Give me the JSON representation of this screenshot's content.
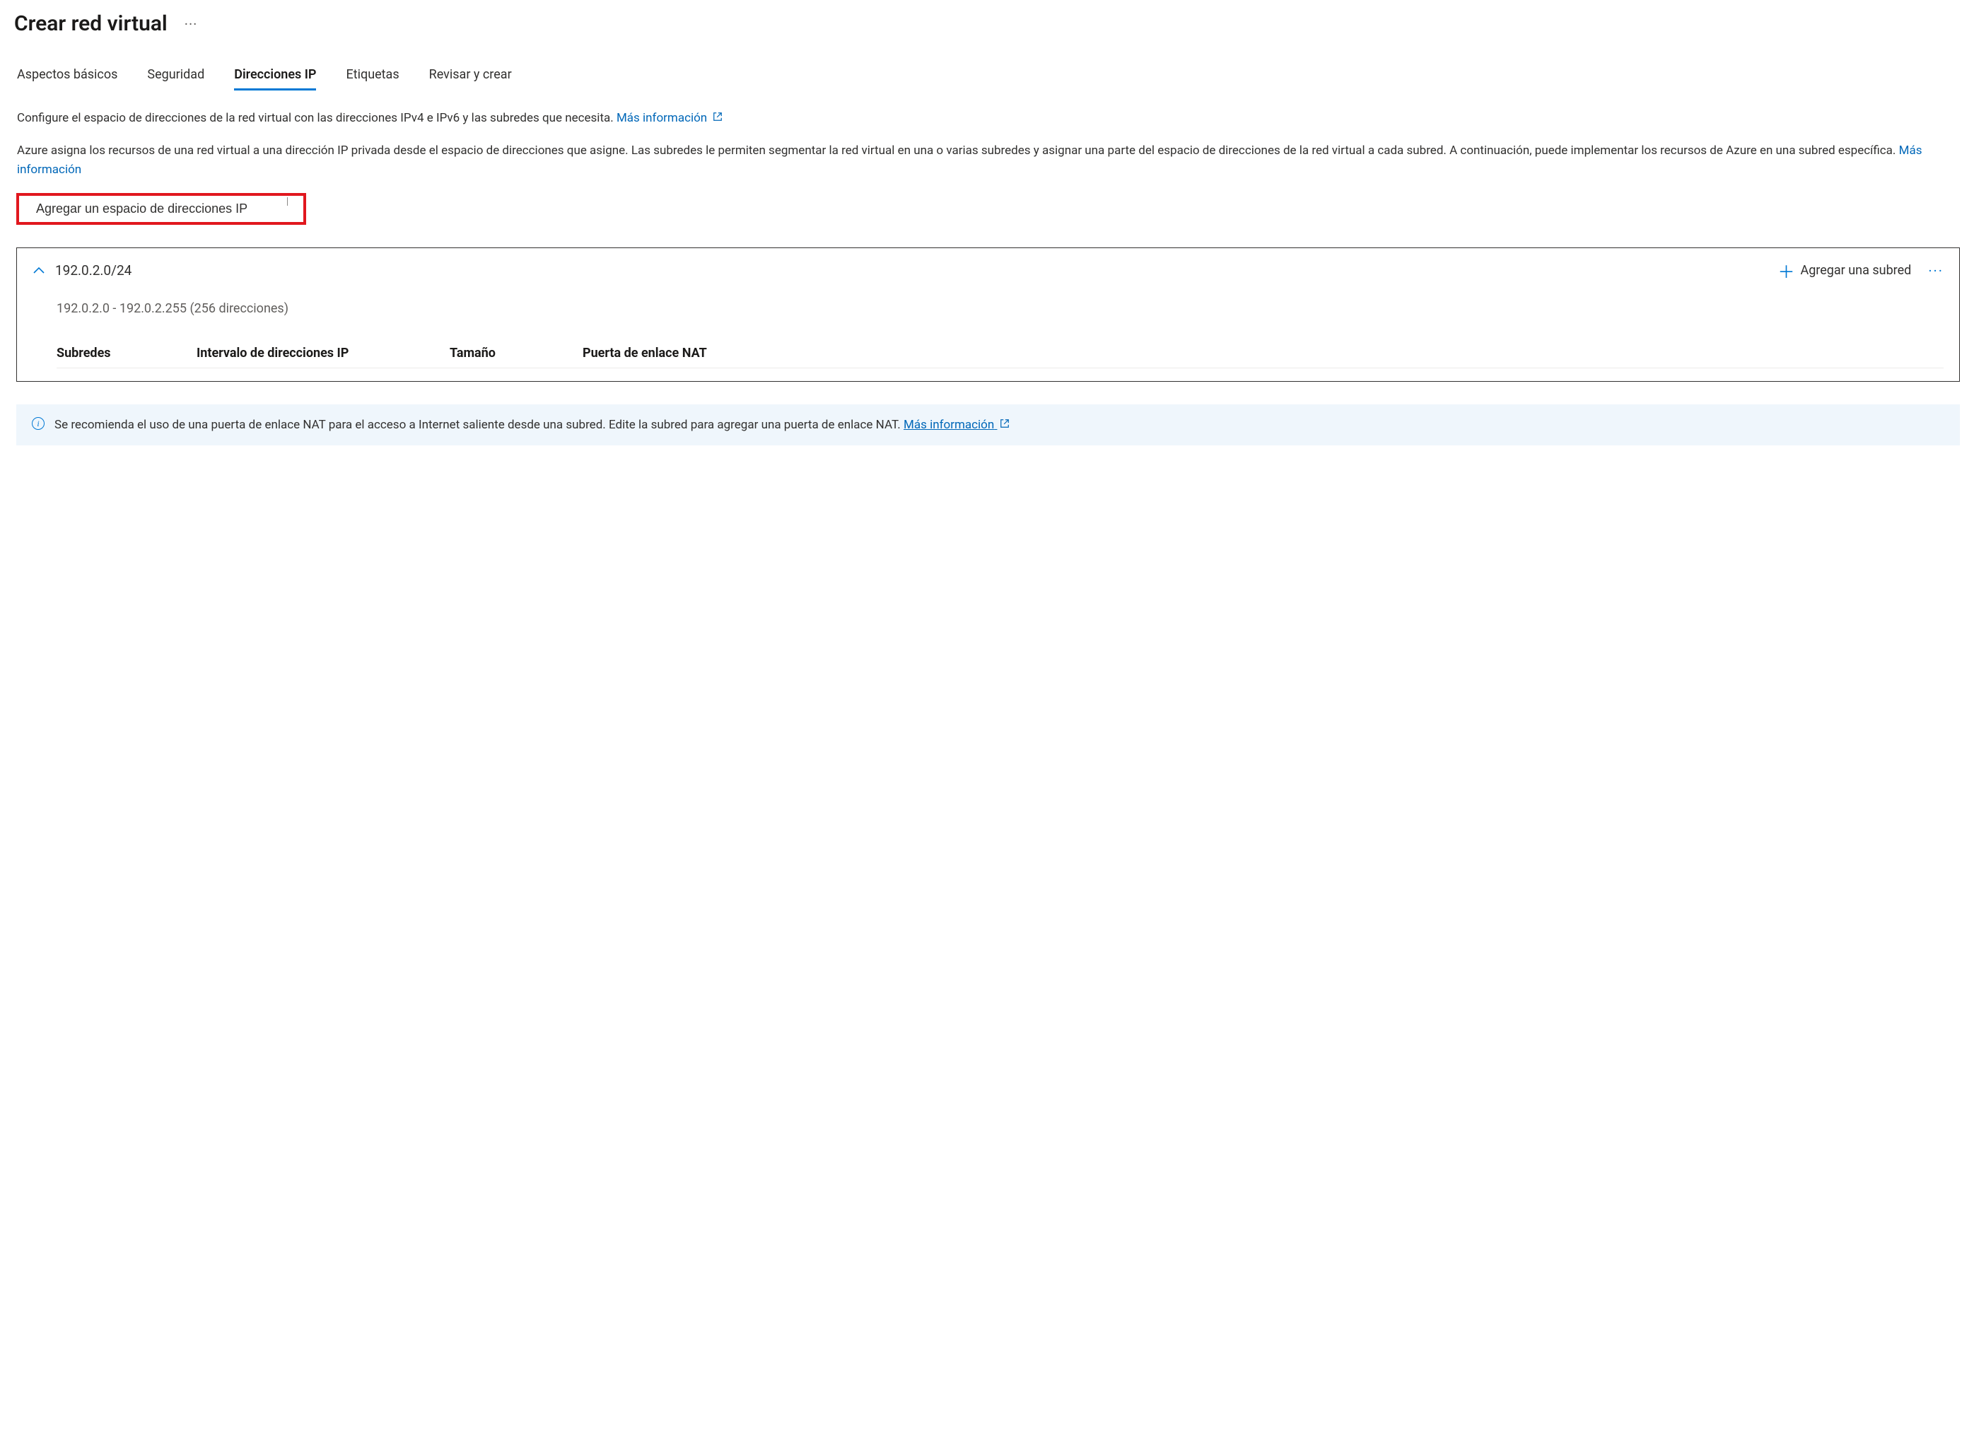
{
  "header": {
    "title": "Crear red virtual"
  },
  "tabs": [
    {
      "label": "Aspectos básicos",
      "active": false
    },
    {
      "label": "Seguridad",
      "active": false
    },
    {
      "label": "Direcciones IP",
      "active": true
    },
    {
      "label": "Etiquetas",
      "active": false
    },
    {
      "label": "Revisar y crear",
      "active": false
    }
  ],
  "intro": {
    "line1": "Configure el espacio de direcciones de la red virtual con las direcciones IPv4 e IPv6 y las subredes que necesita.",
    "more_info_1": "Más información",
    "line2": "Azure asigna los recursos de una red virtual a una dirección IP privada desde el espacio de direcciones que asigne. Las subredes le permiten segmentar la red virtual en una o varias subredes y asignar una parte del espacio de direcciones de la red virtual a cada subred. A continuación, puede implementar los recursos de Azure en una subred específica.",
    "more_info_2": "Más información"
  },
  "add_ip_space_label": "Agregar un espacio de direcciones IP",
  "ip_space": {
    "cidr": "192.0.2.0/24",
    "range_description": "192.0.2.0 - 192.0.2.255 (256 direcciones)",
    "add_subnet_label": "Agregar una subred",
    "columns": {
      "subnets": "Subredes",
      "ip_range": "Intervalo de direcciones IP",
      "size": "Tamaño",
      "nat_gateway": "Puerta de enlace NAT"
    }
  },
  "info_banner": {
    "text": "Se recomienda el uso de una puerta de enlace NAT para el acceso a Internet saliente desde una subred. Edite la subred para agregar una puerta de enlace NAT.",
    "more_info": "Más información"
  }
}
